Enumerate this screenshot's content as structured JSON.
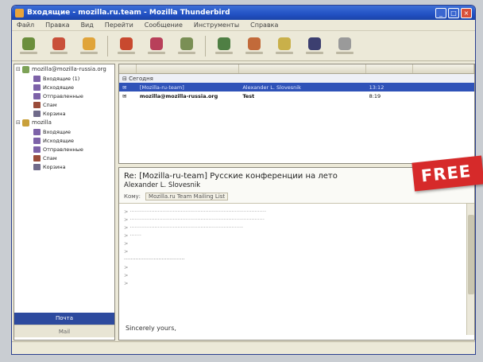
{
  "window": {
    "title": "Входящие - mozilla.ru.team - Mozilla Thunderbird",
    "controls": [
      "minimize",
      "maximize",
      "close"
    ]
  },
  "menubar": [
    "Файл",
    "Правка",
    "Вид",
    "Перейти",
    "Сообщение",
    "Инструменты",
    "Справка"
  ],
  "toolbar": {
    "buttons": [
      {
        "name": "get-mail",
        "color": "#6b8e3c"
      },
      {
        "name": "write",
        "color": "#c9503a"
      },
      {
        "name": "address-book",
        "color": "#e0a43a"
      },
      {
        "name": "reply",
        "color": "#c8492f"
      },
      {
        "name": "reply-all",
        "color": "#b8405a"
      },
      {
        "name": "forward",
        "color": "#7a8f55"
      },
      {
        "name": "delete",
        "color": "#4f7f44"
      },
      {
        "name": "junk",
        "color": "#c26a3a"
      },
      {
        "name": "print",
        "color": "#c9b04a"
      },
      {
        "name": "stop",
        "color": "#3c3f70"
      },
      {
        "name": "search",
        "color": "#9a9a9a"
      }
    ]
  },
  "folders": {
    "accounts": [
      {
        "name": "mozilla@mozilla-russia.org",
        "items": [
          {
            "label": "Входящие (1)",
            "color": "#7d62a8"
          },
          {
            "label": "Исходящие",
            "color": "#7d62a8"
          },
          {
            "label": "Отправленные",
            "color": "#7d62a8"
          },
          {
            "label": "Спам",
            "color": "#9a4c3a"
          },
          {
            "label": "Корзина",
            "color": "#6f6a8a"
          }
        ]
      },
      {
        "name": "mozilla",
        "items": [
          {
            "label": "Входящие",
            "color": "#7d62a8"
          },
          {
            "label": "Исходящие",
            "color": "#7d62a8"
          },
          {
            "label": "Отправленные",
            "color": "#7d62a8"
          },
          {
            "label": "Спам",
            "color": "#9a4c3a"
          },
          {
            "label": "Корзина",
            "color": "#6f6a8a"
          }
        ]
      }
    ],
    "footer_active": "Почта",
    "footer_plain": "Mail"
  },
  "threads": {
    "group_label": "Сегодня",
    "rows": [
      {
        "subject": "[Mozilla-ru-team]",
        "from": "Alexander L. Slovesnik",
        "date": "13:12",
        "selected": true
      },
      {
        "subject": "mozilla@mozilla-russia.org",
        "from": "Test",
        "date": "8:19",
        "selected": false
      }
    ]
  },
  "preview": {
    "subject": "Re: [Mozilla-ru-team] Русские конференции на лето",
    "from": "Alexander L. Slovesnik",
    "to_label": "Кому:",
    "to_value": "Mozilla.ru Team Mailing List",
    "signoff": "Sincerely yours,"
  },
  "badge": {
    "text": "FREE",
    "color": "#d62a2a"
  }
}
